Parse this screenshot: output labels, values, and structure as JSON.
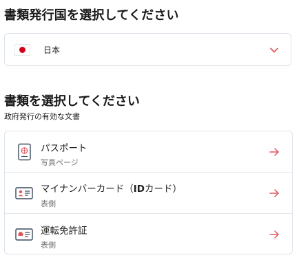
{
  "issuing_country": {
    "heading": "書類発行国を選択してください",
    "selected": "日本",
    "flag_color": "#d0021b",
    "dropdown_icon": "chevron-down-icon",
    "accent": "#e0565b"
  },
  "documents": {
    "heading": "書類を選択してください",
    "subheading": "政府発行の有効な文書",
    "items": [
      {
        "title": "パスポート",
        "subtitle": "写真ページ",
        "icon": "passport-icon"
      },
      {
        "title_prefix": "マイナンバーカード（",
        "title_bold": "ID",
        "title_suffix": "カード）",
        "subtitle": "表側",
        "icon": "id-card-icon"
      },
      {
        "title": "運転免許証",
        "subtitle": "表側",
        "icon": "drivers-license-icon"
      }
    ],
    "arrow_icon": "arrow-right-icon"
  }
}
